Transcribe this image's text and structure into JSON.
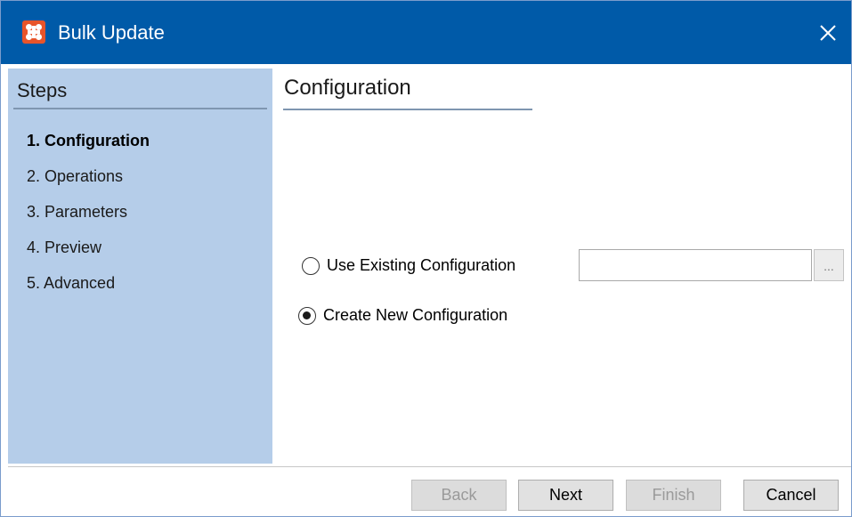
{
  "window": {
    "title": "Bulk Update",
    "accent": "#005aa8",
    "icon": "app-logo-icon"
  },
  "sidebar": {
    "heading": "Steps",
    "background": "#b5cde9",
    "items": [
      {
        "label": "1. Configuration",
        "active": true
      },
      {
        "label": "2. Operations",
        "active": false
      },
      {
        "label": "3. Parameters",
        "active": false
      },
      {
        "label": "4. Preview",
        "active": false
      },
      {
        "label": "5. Advanced",
        "active": false
      }
    ]
  },
  "main": {
    "heading": "Configuration",
    "options": [
      {
        "label": "Use Existing Configuration",
        "checked": false
      },
      {
        "label": "Create New Configuration",
        "checked": true
      }
    ],
    "config_input": {
      "value": "",
      "placeholder": ""
    },
    "browse_label": "..."
  },
  "footer": {
    "back": "Back",
    "next": "Next",
    "finish": "Finish",
    "cancel": "Cancel"
  }
}
